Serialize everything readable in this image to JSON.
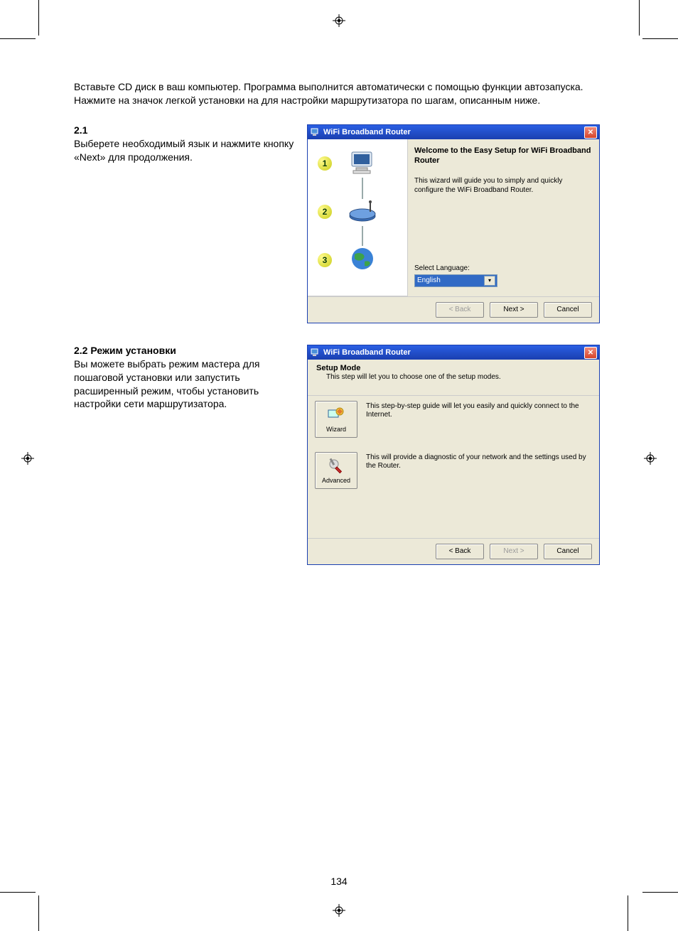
{
  "intro": "Вставьте CD диск в ваш компьютер. Программа выполнится автоматически с помощью функции автозапуска. Нажмите на значок легкой установки на для настройки маршрутизатора по шагам, описанным ниже.",
  "sec1": {
    "num": "2.1",
    "body": "Выберете необходимый язык и нажмите кнопку «Next» для продолжения."
  },
  "sec2": {
    "num": "2.2",
    "title": "Режим установки",
    "body": "Вы можете выбрать режим мастера для пошаговой установки или запустить расширенный режим, чтобы установить настройки сети маршрутизатора."
  },
  "dlg1": {
    "title": "WiFi Broadband Router",
    "welcome": "Welcome to the Easy Setup for WiFi Broadband Router",
    "sub": "This wizard will guide you to simply and quickly configure the WiFi Broadband Router.",
    "lang_label": "Select Language:",
    "lang_value": "English",
    "steps": {
      "s1": "1",
      "s2": "2",
      "s3": "3"
    },
    "btn_back": "< Back",
    "btn_next": "Next >",
    "btn_cancel": "Cancel"
  },
  "dlg2": {
    "title": "WiFi Broadband Router",
    "header_title": "Setup Mode",
    "header_sub": "This step will let you to choose one of the setup modes.",
    "wizard_label": "Wizard",
    "wizard_desc": "This step-by-step guide will let you easily and quickly connect to the Internet.",
    "advanced_label": "Advanced",
    "advanced_desc": "This will provide a diagnostic of your network and the settings used by the Router.",
    "btn_back": "< Back",
    "btn_next": "Next >",
    "btn_cancel": "Cancel"
  },
  "page_number": "134"
}
